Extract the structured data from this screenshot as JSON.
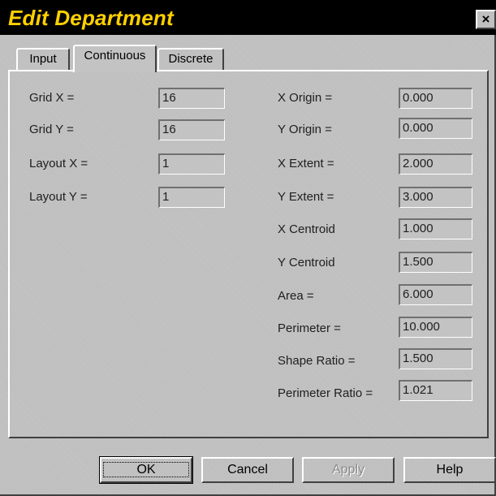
{
  "window": {
    "title": "Edit Department",
    "close_glyph": "×"
  },
  "tabs": [
    {
      "label": "Input",
      "active": false
    },
    {
      "label": "Continuous",
      "active": true
    },
    {
      "label": "Discrete",
      "active": false
    }
  ],
  "left_fields": [
    {
      "label": "Grid X =",
      "value": "16"
    },
    {
      "label": "Grid Y =",
      "value": "16"
    },
    {
      "label": "Layout X =",
      "value": "1"
    },
    {
      "label": "Layout Y =",
      "value": "1"
    }
  ],
  "right_fields": [
    {
      "label": "X Origin =",
      "value": "0.000"
    },
    {
      "label": "Y Origin =",
      "value": "0.000"
    },
    {
      "label": "X Extent =",
      "value": "2.000"
    },
    {
      "label": "Y Extent =",
      "value": "3.000"
    },
    {
      "label": "X Centroid",
      "value": "1.000"
    },
    {
      "label": "Y Centroid",
      "value": "1.500"
    },
    {
      "label": "Area =",
      "value": "6.000"
    },
    {
      "label": "Perimeter =",
      "value": "10.000"
    },
    {
      "label": "Shape Ratio =",
      "value": "1.500"
    },
    {
      "label": "Perimeter Ratio =",
      "value": "1.021"
    }
  ],
  "buttons": {
    "ok": "OK",
    "cancel": "Cancel",
    "apply": "Apply",
    "help": "Help"
  },
  "colors": {
    "title_bar": "#000000",
    "title_text": "#ffd000",
    "face": "#c3c3c3"
  }
}
